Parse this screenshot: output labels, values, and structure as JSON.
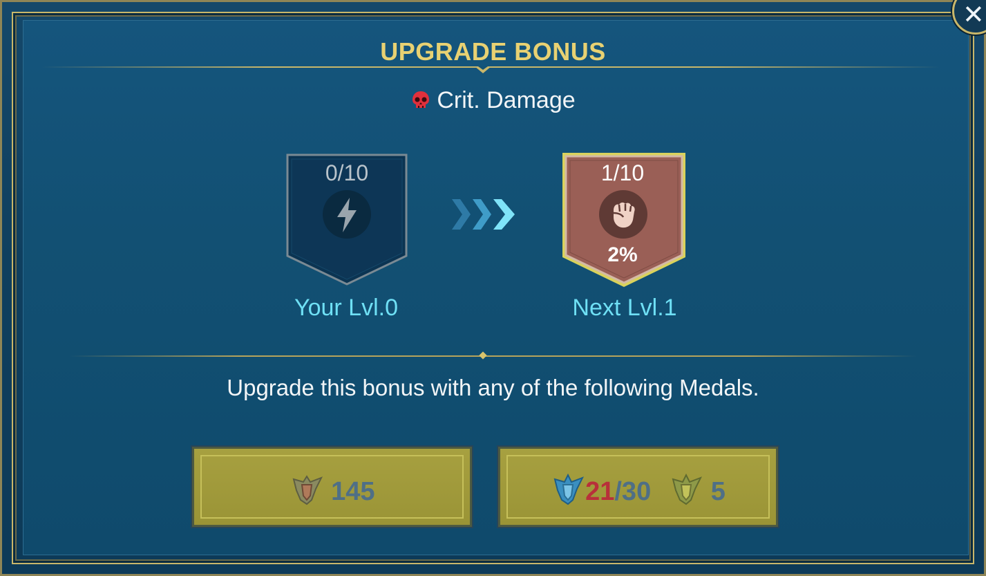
{
  "dialog": {
    "title": "UPGRADE BONUS",
    "close_icon": "close-icon"
  },
  "bonus": {
    "stat_icon": "skull-icon",
    "stat_name": "Crit. Damage"
  },
  "current": {
    "count": "0/10",
    "icon": "lightning-icon",
    "label": "Your Lvl.0"
  },
  "next": {
    "count": "1/10",
    "icon": "fist-icon",
    "value": "2%",
    "label": "Next Lvl.1"
  },
  "instruction": "Upgrade this bonus with any of the following Medals.",
  "options": [
    {
      "medals": [
        {
          "icon": "bronze-medal-icon",
          "amount": "145"
        }
      ]
    },
    {
      "medals": [
        {
          "icon": "silver-medal-icon",
          "have": "21",
          "need": "/30"
        },
        {
          "icon": "gold-medal-icon",
          "amount": "5"
        }
      ]
    }
  ],
  "colors": {
    "title": "#e8d172",
    "level_label": "#6fe0f5",
    "next_badge": "#9a5f56",
    "insufficient": "#b8303a",
    "button": "#a7a040"
  }
}
